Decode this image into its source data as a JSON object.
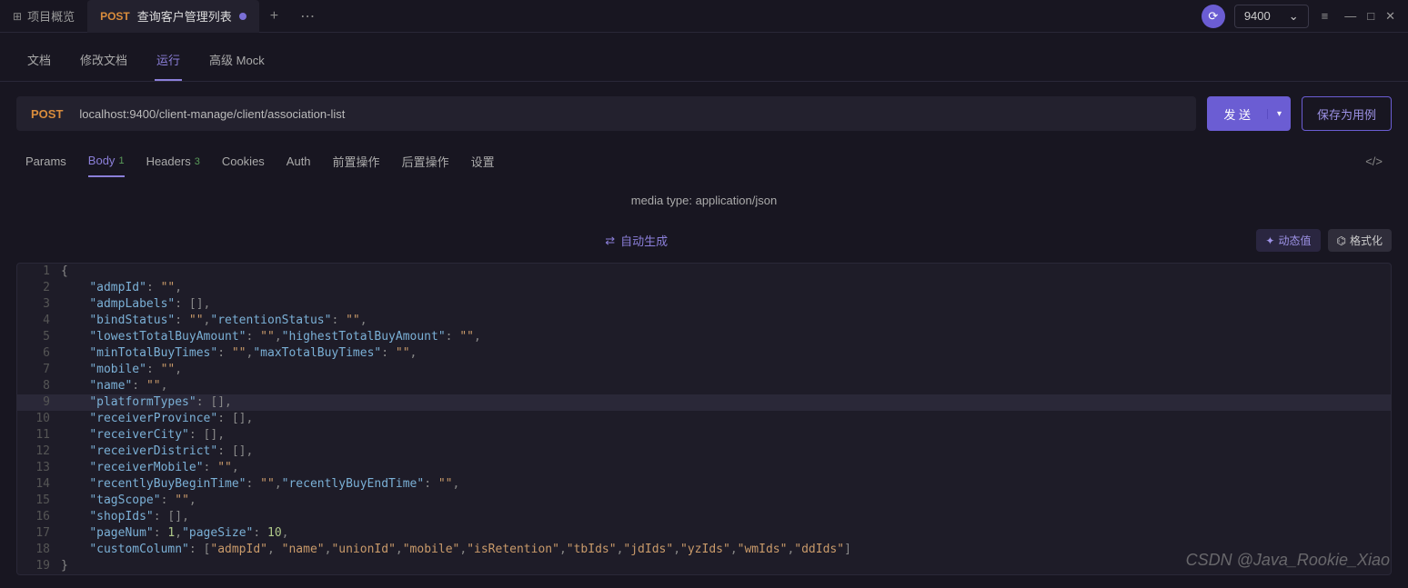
{
  "topbar": {
    "overview_label": "项目概览",
    "tab_method": "POST",
    "tab_title": "查询客户管理列表",
    "env_value": "9400"
  },
  "subtabs": {
    "doc": "文档",
    "edit_doc": "修改文档",
    "run": "运行",
    "mock": "高级 Mock"
  },
  "request": {
    "method": "POST",
    "url": "localhost:9400/client-manage/client/association-list",
    "send_label": "发 送",
    "save_label": "保存为用例"
  },
  "req_tabs": {
    "params": "Params",
    "body": "Body",
    "body_badge": "1",
    "headers": "Headers",
    "headers_badge": "3",
    "cookies": "Cookies",
    "auth": "Auth",
    "pre": "前置操作",
    "post": "后置操作",
    "settings": "设置"
  },
  "media_type_label": "media type: application/json",
  "auto_gen_label": "自动生成",
  "dyn_val_label": "动态值",
  "format_label": "格式化",
  "code_lines": [
    {
      "n": 1,
      "indent": 0,
      "tokens": [
        {
          "t": "punc",
          "v": "{"
        }
      ]
    },
    {
      "n": 2,
      "indent": 1,
      "tokens": [
        {
          "t": "key",
          "v": "\"admpId\""
        },
        {
          "t": "punc",
          "v": ": "
        },
        {
          "t": "str",
          "v": "\"\""
        },
        {
          "t": "punc",
          "v": ","
        }
      ]
    },
    {
      "n": 3,
      "indent": 1,
      "tokens": [
        {
          "t": "key",
          "v": "\"admpLabels\""
        },
        {
          "t": "punc",
          "v": ": []"
        },
        {
          "t": "punc",
          "v": ","
        }
      ]
    },
    {
      "n": 4,
      "indent": 1,
      "tokens": [
        {
          "t": "key",
          "v": "\"bindStatus\""
        },
        {
          "t": "punc",
          "v": ": "
        },
        {
          "t": "str",
          "v": "\"\""
        },
        {
          "t": "punc",
          "v": ","
        },
        {
          "t": "key",
          "v": "\"retentionStatus\""
        },
        {
          "t": "punc",
          "v": ": "
        },
        {
          "t": "str",
          "v": "\"\""
        },
        {
          "t": "punc",
          "v": ","
        }
      ]
    },
    {
      "n": 5,
      "indent": 1,
      "tokens": [
        {
          "t": "key",
          "v": "\"lowestTotalBuyAmount\""
        },
        {
          "t": "punc",
          "v": ": "
        },
        {
          "t": "str",
          "v": "\"\""
        },
        {
          "t": "punc",
          "v": ","
        },
        {
          "t": "key",
          "v": "\"highestTotalBuyAmount\""
        },
        {
          "t": "punc",
          "v": ": "
        },
        {
          "t": "str",
          "v": "\"\""
        },
        {
          "t": "punc",
          "v": ","
        }
      ]
    },
    {
      "n": 6,
      "indent": 1,
      "tokens": [
        {
          "t": "key",
          "v": "\"minTotalBuyTimes\""
        },
        {
          "t": "punc",
          "v": ": "
        },
        {
          "t": "str",
          "v": "\"\""
        },
        {
          "t": "punc",
          "v": ","
        },
        {
          "t": "key",
          "v": "\"maxTotalBuyTimes\""
        },
        {
          "t": "punc",
          "v": ": "
        },
        {
          "t": "str",
          "v": "\"\""
        },
        {
          "t": "punc",
          "v": ","
        }
      ]
    },
    {
      "n": 7,
      "indent": 1,
      "tokens": [
        {
          "t": "key",
          "v": "\"mobile\""
        },
        {
          "t": "punc",
          "v": ": "
        },
        {
          "t": "str",
          "v": "\"\""
        },
        {
          "t": "punc",
          "v": ","
        }
      ]
    },
    {
      "n": 8,
      "indent": 1,
      "tokens": [
        {
          "t": "key",
          "v": "\"name\""
        },
        {
          "t": "punc",
          "v": ": "
        },
        {
          "t": "str",
          "v": "\"\""
        },
        {
          "t": "punc",
          "v": ","
        }
      ]
    },
    {
      "n": 9,
      "indent": 1,
      "hl": true,
      "tokens": [
        {
          "t": "key",
          "v": "\"platformTypes\""
        },
        {
          "t": "punc",
          "v": ": []"
        },
        {
          "t": "punc",
          "v": ","
        }
      ]
    },
    {
      "n": 10,
      "indent": 1,
      "tokens": [
        {
          "t": "key",
          "v": "\"receiverProvince\""
        },
        {
          "t": "punc",
          "v": ": []"
        },
        {
          "t": "punc",
          "v": ","
        }
      ]
    },
    {
      "n": 11,
      "indent": 1,
      "tokens": [
        {
          "t": "key",
          "v": "\"receiverCity\""
        },
        {
          "t": "punc",
          "v": ": []"
        },
        {
          "t": "punc",
          "v": ","
        }
      ]
    },
    {
      "n": 12,
      "indent": 1,
      "tokens": [
        {
          "t": "key",
          "v": "\"receiverDistrict\""
        },
        {
          "t": "punc",
          "v": ": []"
        },
        {
          "t": "punc",
          "v": ","
        }
      ]
    },
    {
      "n": 13,
      "indent": 1,
      "tokens": [
        {
          "t": "key",
          "v": "\"receiverMobile\""
        },
        {
          "t": "punc",
          "v": ": "
        },
        {
          "t": "str",
          "v": "\"\""
        },
        {
          "t": "punc",
          "v": ","
        }
      ]
    },
    {
      "n": 14,
      "indent": 1,
      "tokens": [
        {
          "t": "key",
          "v": "\"recentlyBuyBeginTime\""
        },
        {
          "t": "punc",
          "v": ": "
        },
        {
          "t": "str",
          "v": "\"\""
        },
        {
          "t": "punc",
          "v": ","
        },
        {
          "t": "key",
          "v": "\"recentlyBuyEndTime\""
        },
        {
          "t": "punc",
          "v": ": "
        },
        {
          "t": "str",
          "v": "\"\""
        },
        {
          "t": "punc",
          "v": ","
        }
      ]
    },
    {
      "n": 15,
      "indent": 1,
      "tokens": [
        {
          "t": "key",
          "v": "\"tagScope\""
        },
        {
          "t": "punc",
          "v": ": "
        },
        {
          "t": "str",
          "v": "\"\""
        },
        {
          "t": "punc",
          "v": ","
        }
      ]
    },
    {
      "n": 16,
      "indent": 1,
      "tokens": [
        {
          "t": "key",
          "v": "\"shopIds\""
        },
        {
          "t": "punc",
          "v": ": []"
        },
        {
          "t": "punc",
          "v": ","
        }
      ]
    },
    {
      "n": 17,
      "indent": 1,
      "tokens": [
        {
          "t": "key",
          "v": "\"pageNum\""
        },
        {
          "t": "punc",
          "v": ": "
        },
        {
          "t": "num",
          "v": "1"
        },
        {
          "t": "punc",
          "v": ","
        },
        {
          "t": "key",
          "v": "\"pageSize\""
        },
        {
          "t": "punc",
          "v": ": "
        },
        {
          "t": "num",
          "v": "10"
        },
        {
          "t": "punc",
          "v": ","
        }
      ]
    },
    {
      "n": 18,
      "indent": 1,
      "tokens": [
        {
          "t": "key",
          "v": "\"customColumn\""
        },
        {
          "t": "punc",
          "v": ": ["
        },
        {
          "t": "str",
          "v": "\"admpId\""
        },
        {
          "t": "punc",
          "v": ", "
        },
        {
          "t": "str",
          "v": "\"name\""
        },
        {
          "t": "punc",
          "v": ","
        },
        {
          "t": "str",
          "v": "\"unionId\""
        },
        {
          "t": "punc",
          "v": ","
        },
        {
          "t": "str",
          "v": "\"mobile\""
        },
        {
          "t": "punc",
          "v": ","
        },
        {
          "t": "str",
          "v": "\"isRetention\""
        },
        {
          "t": "punc",
          "v": ","
        },
        {
          "t": "str",
          "v": "\"tbIds\""
        },
        {
          "t": "punc",
          "v": ","
        },
        {
          "t": "str",
          "v": "\"jdIds\""
        },
        {
          "t": "punc",
          "v": ","
        },
        {
          "t": "str",
          "v": "\"yzIds\""
        },
        {
          "t": "punc",
          "v": ","
        },
        {
          "t": "str",
          "v": "\"wmIds\""
        },
        {
          "t": "punc",
          "v": ","
        },
        {
          "t": "str",
          "v": "\"ddIds\""
        },
        {
          "t": "punc",
          "v": "]"
        }
      ]
    },
    {
      "n": 19,
      "indent": 0,
      "tokens": [
        {
          "t": "punc",
          "v": "}"
        }
      ]
    }
  ],
  "watermark": "CSDN @Java_Rookie_Xiao"
}
